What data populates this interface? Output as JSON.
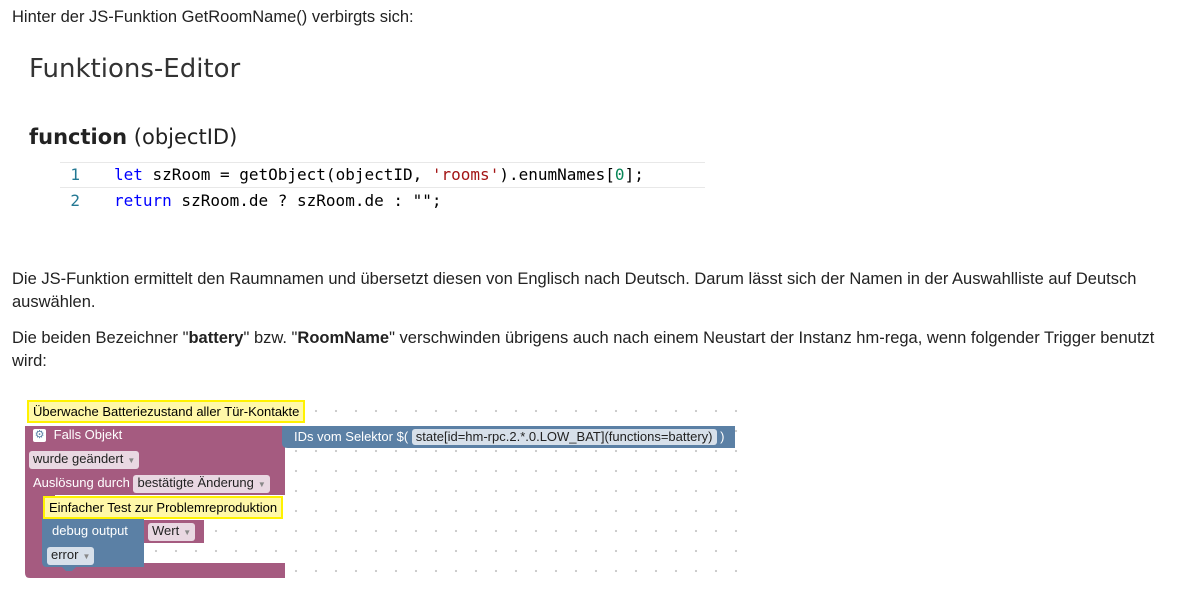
{
  "intro": "Hinter der JS-Funktion GetRoomName() verbirgts sich:",
  "editor": {
    "title": "Funktions-Editor",
    "fn_keyword": "function",
    "fn_params": "(objectID)",
    "lines": [
      {
        "num": "1",
        "kw": "let",
        "pre": " szRoom = getObject(objectID, ",
        "str": "'rooms'",
        "mid": ").enumNames[",
        "numlit": "0",
        "post": "];"
      },
      {
        "num": "2",
        "kw": "return",
        "pre": " szRoom.de ? szRoom.de : ",
        "str": "\"\"",
        "mid": ";",
        "numlit": "",
        "post": ""
      }
    ]
  },
  "para1": "Die JS-Funktion ermittelt den Raumnamen und übersetzt diesen von Englisch nach Deutsch. Darum lässt sich der Namen in der Auswahlliste auf Deutsch auswählen.",
  "para2": {
    "a": "Die beiden Bezeichner \"",
    "b1": "battery",
    "c": "\" bzw. \"",
    "b2": "RoomName",
    "d": "\" verschwinden übrigens auch nach einem Neustart der Instanz hm-rega, wenn folgender Trigger benutzt wird:"
  },
  "blockly": {
    "comment_top": "Überwache Batteriezustand aller Tür-Kontakte",
    "trigger_label": "Falls Objekt",
    "trigger_state": "wurde geändert",
    "trigger_cause_label": "Auslösung durch",
    "trigger_cause_value": "bestätigte Änderung",
    "selector_label": "IDs vom Selektor $(",
    "selector_value": "state[id=hm-rpc.2.*.0.LOW_BAT](functions=battery)",
    "selector_close": ")",
    "comment_inner": "Einfacher Test zur Problemreproduktion",
    "debug_label": "debug output",
    "debug_value": "Wert",
    "debug_level": "error",
    "colors": {
      "trigger": "#a55b80",
      "selector": "#5b80a5",
      "debug": "#5b80a5",
      "comment_bg": "#fff8a8",
      "comment_border": "#fff200"
    }
  }
}
